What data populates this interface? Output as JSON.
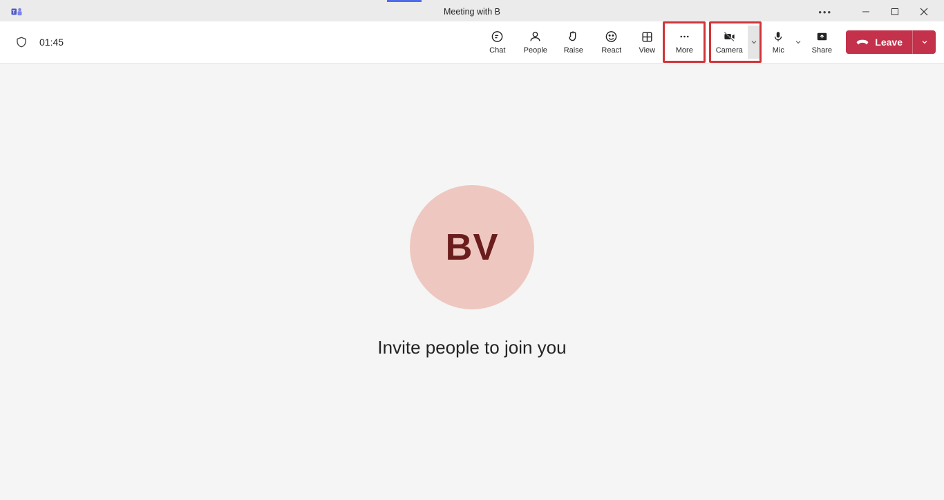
{
  "window": {
    "title": "Meeting with B"
  },
  "timer": "01:45",
  "toolbar": {
    "chat": "Chat",
    "people": "People",
    "raise": "Raise",
    "react": "React",
    "view": "View",
    "more": "More",
    "camera": "Camera",
    "mic": "Mic",
    "share": "Share"
  },
  "leave": {
    "label": "Leave"
  },
  "main": {
    "avatar_initials": "BV",
    "invite_text": "Invite people to join you"
  },
  "highlights": [
    "more-button",
    "camera-button"
  ]
}
